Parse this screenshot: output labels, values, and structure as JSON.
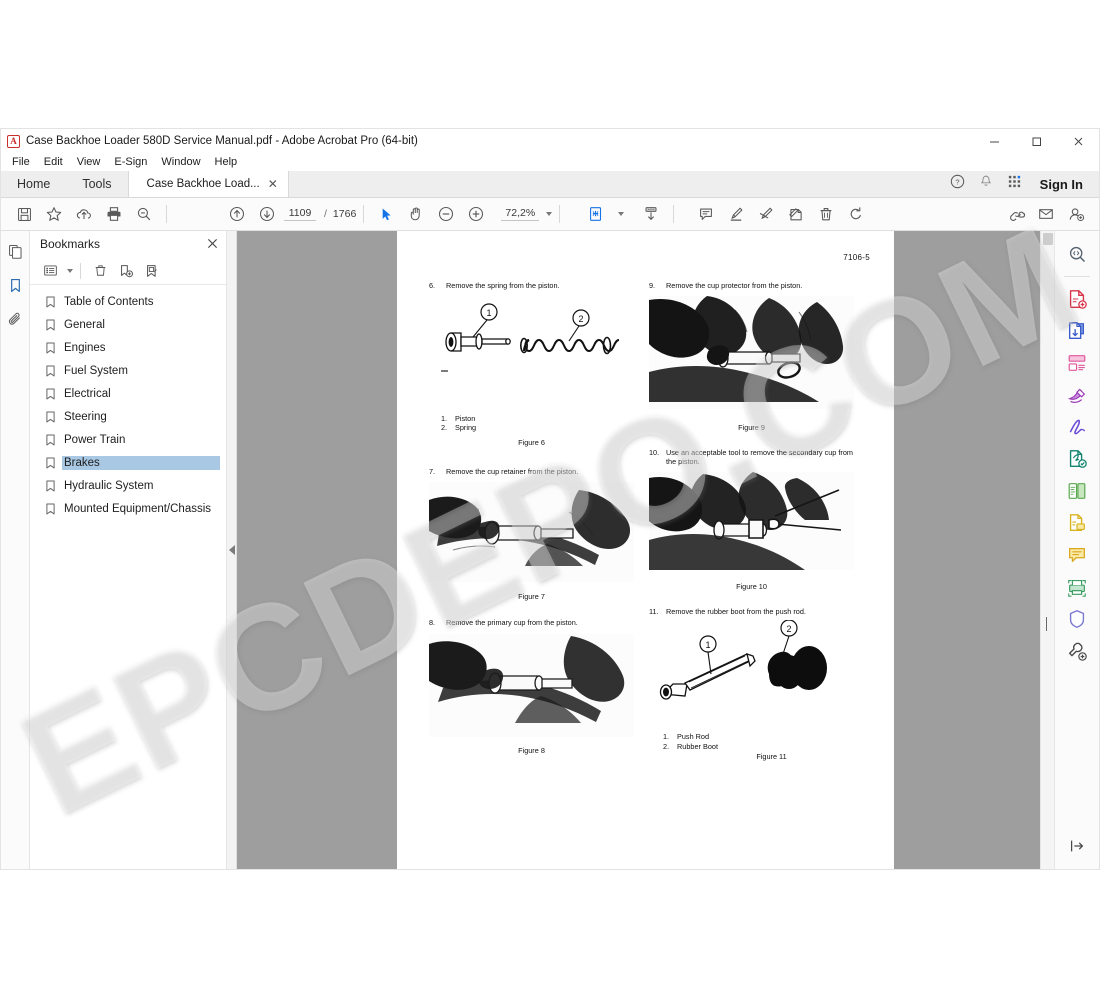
{
  "window": {
    "title": "Case Backhoe Loader 580D Service Manual.pdf - Adobe Acrobat Pro (64-bit)",
    "app_icon": "acrobat-logo-icon",
    "minimize": "–",
    "maximize": "☐",
    "close": "✕"
  },
  "menubar": [
    {
      "label": "File"
    },
    {
      "label": "Edit"
    },
    {
      "label": "View"
    },
    {
      "label": "E-Sign"
    },
    {
      "label": "Window"
    },
    {
      "label": "Help"
    }
  ],
  "tabstrip": {
    "home": "Home",
    "tools": "Tools",
    "doc_tab": "Case Backhoe Load...",
    "doc_tab_close": "✕",
    "help_icon": "help-circle-icon",
    "bell_icon": "notification-bell-icon",
    "apps_icon": "app-grid-icon",
    "signin": "Sign In"
  },
  "toolbar": {
    "save_icon": "save-icon",
    "star_icon": "add-to-favorites-icon",
    "upload_icon": "upload-to-cloud-icon",
    "print_icon": "print-icon",
    "find_icon": "find-text-icon",
    "prev_page_icon": "previous-page-icon",
    "next_page_icon": "next-page-icon",
    "page_current": "1109",
    "page_separator": "/",
    "page_total": "1766",
    "select_tool_icon": "select-cursor-icon",
    "hand_tool_icon": "hand-pan-icon",
    "zoom_out_icon": "zoom-out-icon",
    "zoom_in_icon": "zoom-in-icon",
    "zoom_level": "72,2%",
    "page_display_icon": "page-fit-icon",
    "scroll_mode_icon": "scroll-mode-icon",
    "comment_icon": "add-comment-icon",
    "highlight_icon": "highlight-text-icon",
    "strikethrough_icon": "strikethrough-text-icon",
    "stamp_icon": "add-stamp-icon",
    "delete_icon": "delete-icon",
    "rotate_icon": "rotate-page-icon",
    "share_link_icon": "share-link-icon",
    "email_icon": "email-icon",
    "add_person_icon": "add-person-icon",
    "accent_color": "#2b6cb0"
  },
  "left_rail": [
    {
      "name": "page-thumbnails-icon",
      "active": false
    },
    {
      "name": "bookmarks-icon",
      "active": true
    },
    {
      "name": "attachments-icon",
      "active": false
    }
  ],
  "bookmarks_panel": {
    "title": "Bookmarks",
    "close_icon": "close-icon",
    "options_icon": "bookmark-options-icon",
    "delete_icon": "delete-bookmark-icon",
    "new_icon": "new-bookmark-icon",
    "edit_icon": "edit-bookmark-icon",
    "highlight_color": "#a8c8e4",
    "items": [
      {
        "label": "Table of Contents",
        "selected": false
      },
      {
        "label": "General",
        "selected": false
      },
      {
        "label": "Engines",
        "selected": false
      },
      {
        "label": "Fuel System",
        "selected": false
      },
      {
        "label": "Electrical",
        "selected": false
      },
      {
        "label": "Steering",
        "selected": false
      },
      {
        "label": "Power Train",
        "selected": false
      },
      {
        "label": "Brakes",
        "selected": true
      },
      {
        "label": "Hydraulic System",
        "selected": false
      },
      {
        "label": "Mounted Equipment/Chassis",
        "selected": false
      }
    ]
  },
  "canvas": {
    "collapse_icon": "collapse-panel-arrow-icon",
    "scrollbar_icon": "vertical-scrollbar",
    "background_color": "#9e9e9e"
  },
  "right_rail": [
    {
      "name": "search-document-icon",
      "color": "#55606e"
    },
    {
      "name": "create-pdf-icon",
      "color": "#d8344a"
    },
    {
      "name": "export-pdf-icon",
      "color": "#3b5ccc"
    },
    {
      "name": "organize-pages-icon",
      "color": "#e0579c"
    },
    {
      "name": "edit-pdf-icon",
      "color": "#9b3bb5"
    },
    {
      "name": "sign-icon",
      "color": "#6a4bd8"
    },
    {
      "name": "request-e-signatures-icon",
      "color": "#11836f"
    },
    {
      "name": "compare-files-icon",
      "color": "#5aa84f"
    },
    {
      "name": "fill-and-sign-icon",
      "color": "#d9b31f"
    },
    {
      "name": "add-comment-icon",
      "color": "#d9a81f"
    },
    {
      "name": "scan-and-ocr-icon",
      "color": "#3f9e63"
    },
    {
      "name": "protect-icon",
      "color": "#7a78cf"
    },
    {
      "name": "more-tools-icon",
      "color": "#4a4a4a"
    }
  ],
  "right_rail_bottom": {
    "name": "expand-tools-panel-icon"
  },
  "document": {
    "page_number_label": "7106-5",
    "left_column": {
      "step6": {
        "num": "6.",
        "text": "Remove the spring from the piston."
      },
      "fig6_legend": [
        {
          "n": "1.",
          "label": "Piston"
        },
        {
          "n": "2.",
          "label": "Spring"
        }
      ],
      "fig6_caption": "Figure 6",
      "step7": {
        "num": "7.",
        "text": "Remove the cup retainer from the piston."
      },
      "fig7_caption": "Figure 7",
      "step8": {
        "num": "8.",
        "text": "Remove the primary cup from the piston."
      },
      "fig8_caption": "Figure 8"
    },
    "right_column": {
      "step9": {
        "num": "9.",
        "text": "Remove the cup protector from the piston."
      },
      "fig9_caption": "Figure 9",
      "step10": {
        "num": "10.",
        "text": "Use an acceptable tool to remove the secondary cup from the piston."
      },
      "fig10_caption": "Figure 10",
      "step11": {
        "num": "11.",
        "text": "Remove the rubber boot from the push rod."
      },
      "fig11_legend": [
        {
          "n": "1.",
          "label": "Push Rod"
        },
        {
          "n": "2.",
          "label": "Rubber Boot"
        }
      ],
      "fig11_caption": "Figure 11"
    },
    "callouts": {
      "one": "1",
      "two": "2"
    }
  },
  "watermark": {
    "text": "EPCDEPO.COM"
  }
}
